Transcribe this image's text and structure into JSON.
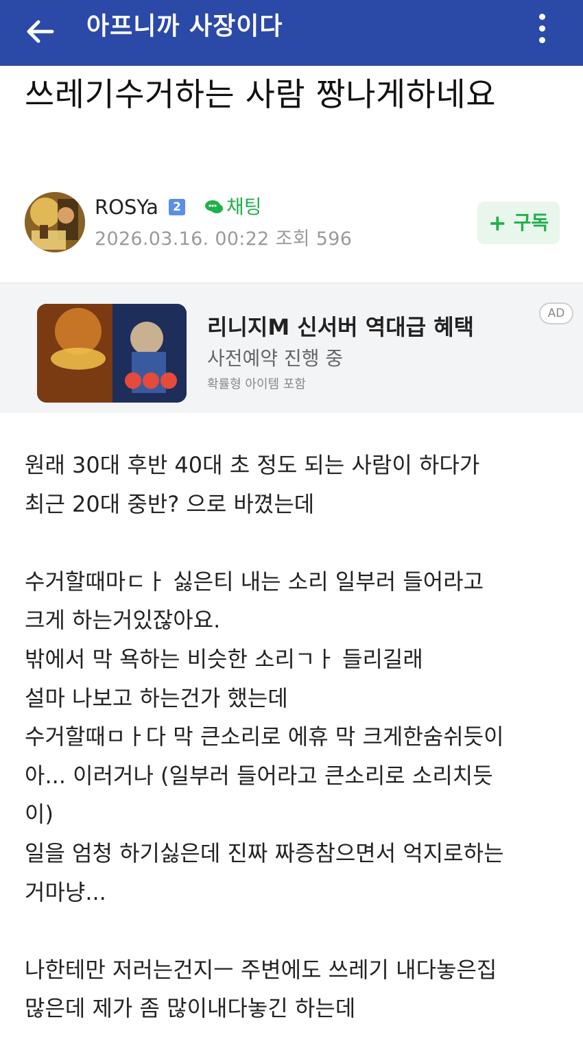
{
  "header": {
    "back_icon": "arrow-left-icon",
    "cafe_title": "아프니까 사장이다",
    "more_icon": "more-vertical-icon",
    "bg_color": "#2b4aa7"
  },
  "post": {
    "title": "쓰레기수거하는 사람 짱나게하네요",
    "author": {
      "name": "ROSYa",
      "level": "2",
      "chat_label": "채팅",
      "chat_icon": "chat-bubble-icon"
    },
    "meta": {
      "date": "2026.03.16. 00:22",
      "views_label": "조회",
      "views": "596"
    },
    "subscribe_label": "구독",
    "body_lines": [
      "원래 30대 후반 40대 초 정도 되는 사람이 하다가",
      "최근 20대 중반? 으로 바꼈는데",
      "",
      "수거할때마ㄷㅏ 싫은티 내는 소리 일부러 들어라고",
      "크게 하는거있잖아요.",
      "밖에서 막 욕하는 비슷한 소리ㄱㅏ 들리길래",
      "설마 나보고 하는건가 했는데",
      "수거할때ㅁㅏ다 막 큰소리로 에휴 막 크게한숨쉬듯이",
      "아... 이러거나 (일부러 들어라고 큰소리로 소리치듯",
      "이)",
      "일을 엄청 하기싫은데 진짜 짜증참으면서 억지로하는",
      "거마냥...",
      "",
      "나한테만 저러는건지ㅡ 주변에도 쓰레기 내다놓은집",
      "많은데 제가 좀 많이내다놓긴 하는데"
    ]
  },
  "ad": {
    "headline": "리니지M 신서버 역대급 혜택",
    "subline": "사전예약 진행 중",
    "note": "확률형 아이템 포함",
    "badge": "AD"
  },
  "colors": {
    "accent_green": "#20b04b",
    "subscribe_bg": "#e8f6ec",
    "meta_gray": "#9a9a9a"
  }
}
